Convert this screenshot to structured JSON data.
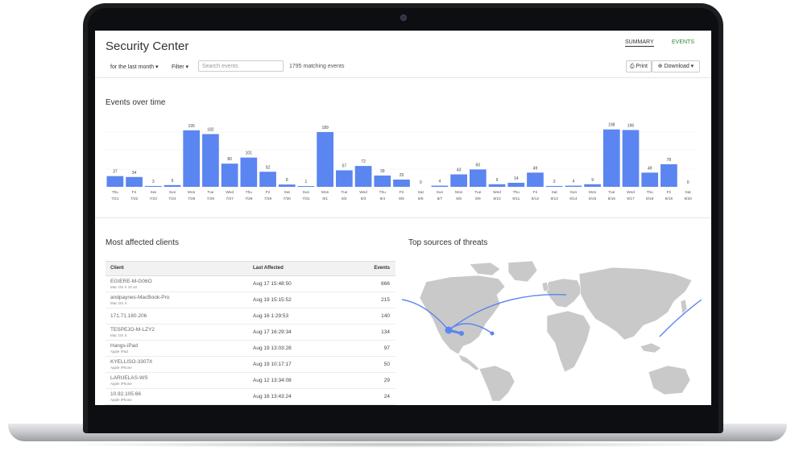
{
  "app": {
    "title": "Security Center"
  },
  "nav": {
    "summary": "SUMMARY",
    "events": "EVENTS"
  },
  "toolbar": {
    "range": "for the last month ▾",
    "filter": "Filter ▾",
    "search_placeholder": "Search events",
    "match_count": "1795 matching events",
    "print": "⎙ Print",
    "download": "⊕ Download ▾"
  },
  "sections": {
    "events_over_time": "Events over time",
    "most_affected": "Most affected clients",
    "top_sources": "Top sources of threats"
  },
  "chart_data": {
    "type": "bar",
    "title": "Events over time",
    "days": [
      "Thu",
      "Fri",
      "Sat",
      "Sun",
      "Mon",
      "Tue",
      "Wed",
      "Thu",
      "Fri",
      "Sat",
      "Sun",
      "Mon",
      "Tue",
      "Wed",
      "Thu",
      "Fri",
      "Sat",
      "Sun",
      "Mon",
      "Tue",
      "Wed",
      "Thu",
      "Fri",
      "Sat",
      "Sun",
      "Mon",
      "Tue",
      "Wed",
      "Thu",
      "Fri",
      "Sat"
    ],
    "dates": [
      "7/21",
      "7/22",
      "7/23",
      "7/24",
      "7/25",
      "7/26",
      "7/27",
      "7/28",
      "7/29",
      "7/30",
      "7/31",
      "8/1",
      "8/2",
      "8/3",
      "8/4",
      "8/5",
      "8/6",
      "8/7",
      "8/8",
      "8/9",
      "8/10",
      "8/11",
      "8/12",
      "8/13",
      "8/14",
      "8/15",
      "8/16",
      "8/17",
      "8/18",
      "8/19",
      "8/20"
    ],
    "values": [
      37,
      34,
      3,
      6,
      195,
      182,
      80,
      101,
      52,
      8,
      1,
      189,
      57,
      72,
      39,
      25,
      0,
      4,
      43,
      60,
      9,
      14,
      49,
      3,
      4,
      9,
      198,
      196,
      49,
      78,
      0
    ],
    "color": "#5b85f0"
  },
  "clients_table": {
    "headers": {
      "client": "Client",
      "last_affected": "Last Affected",
      "events": "Events"
    },
    "rows": [
      {
        "name": "EGIERE-M-G06O",
        "os": "Mac OS X 10.10",
        "date": "Aug 17 15:48:50",
        "events": "666"
      },
      {
        "name": "andpaynes-MacBook-Pro",
        "os": "Mac OS X",
        "date": "Aug 19 15:15:52",
        "events": "215"
      },
      {
        "name": "171.71.180.206",
        "os": "",
        "date": "Aug 16 1:29:53",
        "events": "140"
      },
      {
        "name": "TESPEJO-M-LZY2",
        "os": "Mac OS X",
        "date": "Aug 17 16:29:34",
        "events": "134"
      },
      {
        "name": "Hangs-iPad",
        "os": "Apple iPad",
        "date": "Aug 19 13:03:28",
        "events": "97"
      },
      {
        "name": "KYELLISO-3307X",
        "os": "Apple iPhone",
        "date": "Aug 19 10:17:17",
        "events": "50"
      },
      {
        "name": "LARUELAS-WS",
        "os": "Apple iPhone",
        "date": "Aug 12 13:34:08",
        "events": "29"
      },
      {
        "name": "10.92.105.66",
        "os": "Apple iPhone",
        "date": "Aug 16 13:43:24",
        "events": "24"
      }
    ]
  },
  "map": {
    "land_color": "#c9c9c9",
    "arc_color": "#5b85f0"
  }
}
